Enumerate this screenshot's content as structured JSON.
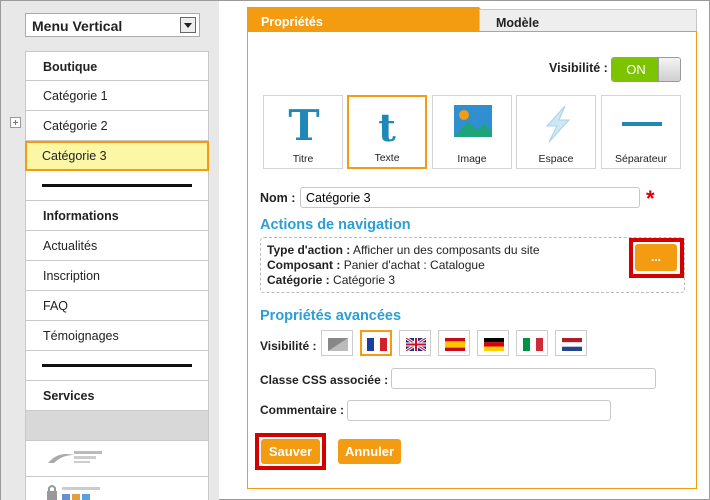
{
  "sidebar": {
    "menu_title": "Menu Vertical",
    "items": [
      {
        "label": "Boutique"
      },
      {
        "label": "Catégorie 1"
      },
      {
        "label": "Catégorie 2"
      },
      {
        "label": "Catégorie 3"
      },
      {
        "label": ""
      },
      {
        "label": "Informations"
      },
      {
        "label": "Actualités"
      },
      {
        "label": "Inscription"
      },
      {
        "label": "FAQ"
      },
      {
        "label": "Témoignages"
      },
      {
        "label": ""
      },
      {
        "label": "Services"
      }
    ]
  },
  "tabs": {
    "active": "Propriétés",
    "other": "Modèle"
  },
  "visibility": {
    "label": "Visibilité :",
    "toggle": "ON"
  },
  "tools": [
    {
      "label": "Titre",
      "icon": "title-icon"
    },
    {
      "label": "Texte",
      "icon": "text-icon"
    },
    {
      "label": "Image",
      "icon": "image-icon"
    },
    {
      "label": "Espace",
      "icon": "space-icon"
    },
    {
      "label": "Séparateur",
      "icon": "separator-icon"
    }
  ],
  "name_field": {
    "label": "Nom :",
    "value": "Catégorie 3",
    "required": "*"
  },
  "navigation": {
    "title": "Actions de navigation",
    "action_type_label": "Type d'action :",
    "action_type_value": "Afficher un des composants du site",
    "component_label": "Composant :",
    "component_value": "Panier d'achat : Catalogue",
    "category_label": "Catégorie :",
    "category_value": "Catégorie 3",
    "button": "..."
  },
  "advanced": {
    "title": "Propriétés avancées",
    "visibility_label": "Visibilité :",
    "flags": [
      "all-languages",
      "french-flag",
      "english-flag",
      "spanish-flag",
      "german-flag",
      "italian-flag",
      "dutch-flag"
    ],
    "css_label": "Classe CSS associée :",
    "comment_label": "Commentaire :"
  },
  "buttons": {
    "save": "Sauver",
    "cancel": "Annuler"
  },
  "colors": {
    "accent": "#f39c12",
    "link": "#2a9fd6",
    "on": "#7cc300",
    "highlight": "#d40000"
  }
}
